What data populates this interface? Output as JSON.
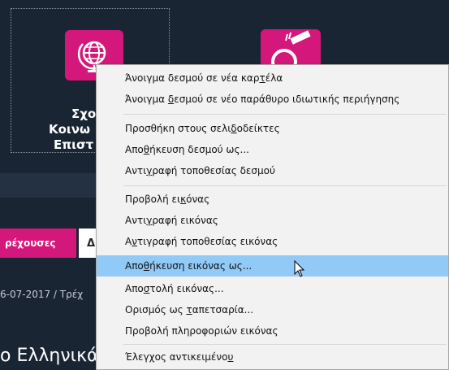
{
  "background": {
    "tile1_title": [
      "Σχο",
      "Κοινω",
      "Επιστ"
    ],
    "tabs": {
      "active": "ρέχουσες",
      "next": "Δ"
    },
    "article_meta": "6-07-2017 / Τρέχ",
    "article_title": "ο Ελληνικά"
  },
  "context_menu": {
    "items": [
      {
        "label": "Άνοιγμα δεσμού σε νέα καρτέλα",
        "pre": "Άνοιγμα δεσμού σε νέα καρ",
        "acc": "τ",
        "post": "έλα"
      },
      {
        "label": "Άνοιγμα δεσμού σε νέο παράθυρο ιδιωτικής περιήγησης",
        "pre": "Άνοιγμα ",
        "acc": "δ",
        "post": "εσμού σε νέο παράθυρο ιδιωτικής περιήγησης"
      },
      {
        "label": "Προσθήκη στους σελιδοδείκτες",
        "pre": "Προσθήκη στους σελι",
        "acc": "δ",
        "post": "οδείκτες"
      },
      {
        "label": "Αποθήκευση δεσμού ως...",
        "pre": "Απο",
        "acc": "θ",
        "post": "ήκευση δεσμού ως..."
      },
      {
        "label": "Αντιγραφή τοποθεσίας δεσμού",
        "pre": "Αντι",
        "acc": "γ",
        "post": "ραφή τοποθεσίας δεσμού"
      },
      {
        "label": "Προβολή εικόνας",
        "pre": "Προβολή ει",
        "acc": "κ",
        "post": "όνας"
      },
      {
        "label": "Αντιγραφή εικόνας",
        "pre": "Αντι",
        "acc": "γ",
        "post": "ραφή εικόνας"
      },
      {
        "label": "Αντιγραφή τοποθεσίας εικόνας",
        "pre": "Α",
        "acc": "ν",
        "post": "τιγραφή τοποθεσίας εικόνας"
      },
      {
        "label": "Αποθήκευση εικόνας ως...",
        "pre": "Απο",
        "acc": "θ",
        "post": "ήκευση εικόνας ως...",
        "highlighted": true
      },
      {
        "label": "Αποστολή εικόνας...",
        "pre": "Απο",
        "acc": "σ",
        "post": "τολή εικόνας..."
      },
      {
        "label": "Ορισμός ως ταπετσαρία...",
        "pre": "Ορισμός ως ",
        "acc": "τ",
        "post": "απετσαρία..."
      },
      {
        "label": "Προβολή πληροφοριών εικόνας",
        "pre": "Προβολή πληροφοριών εικόνας",
        "acc": "",
        "post": ""
      },
      {
        "label": "Έλεγχος αντικειμένου",
        "pre": "Έλεγχος αντικειμένο",
        "acc": "υ",
        "post": ""
      }
    ]
  },
  "colors": {
    "page_bg": "#1a2534",
    "accent": "#d4177a",
    "highlight": "#91c9f7",
    "menu_bg": "#f2f2f2"
  },
  "icons": [
    "globe-icon",
    "pencil-ruler-icon",
    "mouse-cursor-icon"
  ]
}
